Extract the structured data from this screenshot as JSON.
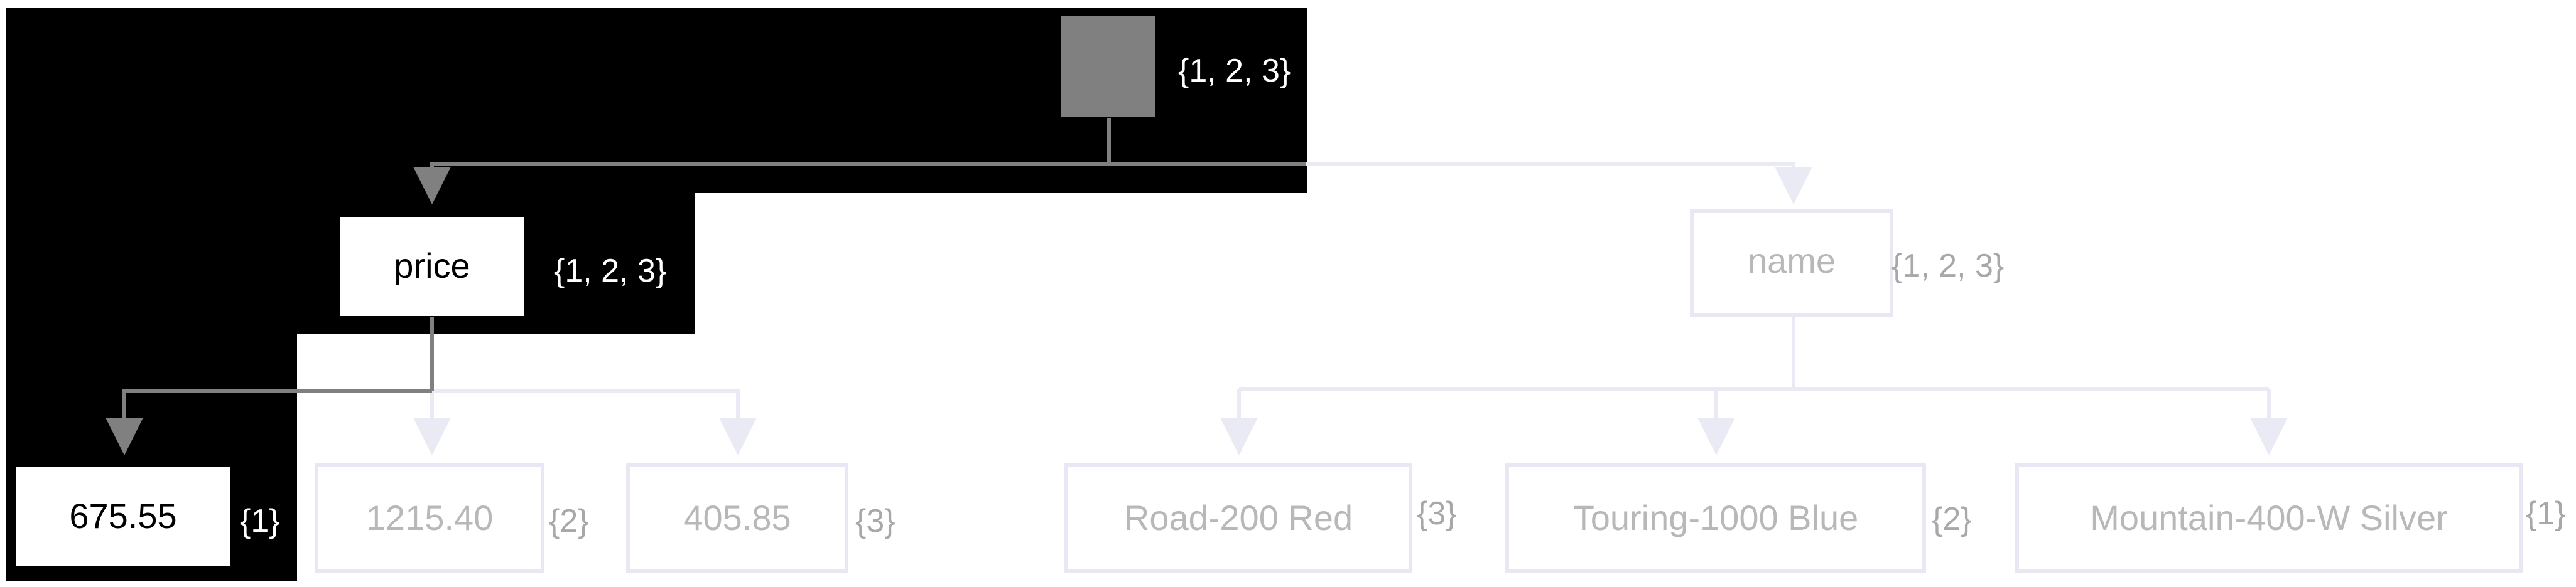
{
  "colors": {
    "highlight_background": "#000000",
    "highlight_box": "#ffffff",
    "highlight_text_on_box": "#000000",
    "highlight_text_on_black": "#ffffff",
    "root_box": "#808080",
    "active_edge": "#808080",
    "faded_edge": "#eaeaf5",
    "faded_box_border": "#e8e8f4",
    "faded_text": "#b8b8b8",
    "faded_set_text": "#a8a8a8"
  },
  "root": {
    "label": "",
    "set": "{1, 2, 3}"
  },
  "price": {
    "label": "price",
    "set": "{1, 2, 3}",
    "children": [
      {
        "label": "675.55",
        "set": "{1}"
      },
      {
        "label": "1215.40",
        "set": "{2}"
      },
      {
        "label": "405.85",
        "set": "{3}"
      }
    ]
  },
  "name": {
    "label": "name",
    "set": "{1, 2, 3}",
    "children": [
      {
        "label": "Road-200 Red",
        "set": "{3}"
      },
      {
        "label": "Touring-1000 Blue",
        "set": "{2}"
      },
      {
        "label": "Mountain-400-W Silver",
        "set": "{1}"
      }
    ]
  }
}
